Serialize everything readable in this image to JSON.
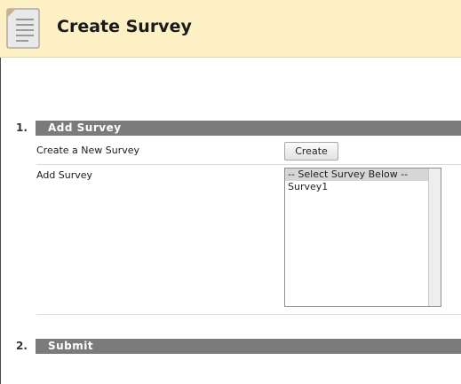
{
  "header": {
    "title": "Create Survey"
  },
  "section1": {
    "number": "1.",
    "title": "Add Survey",
    "create_label": "Create a New Survey",
    "create_button": "Create",
    "add_label": "Add Survey",
    "options": [
      "-- Select Survey Below --",
      "Survey1"
    ]
  },
  "section2": {
    "number": "2.",
    "title": "Submit"
  },
  "colors": {
    "header_bg": "#fcf0c4",
    "step_bar": "#7b7b7b"
  },
  "icons": {
    "page": "document-icon"
  }
}
